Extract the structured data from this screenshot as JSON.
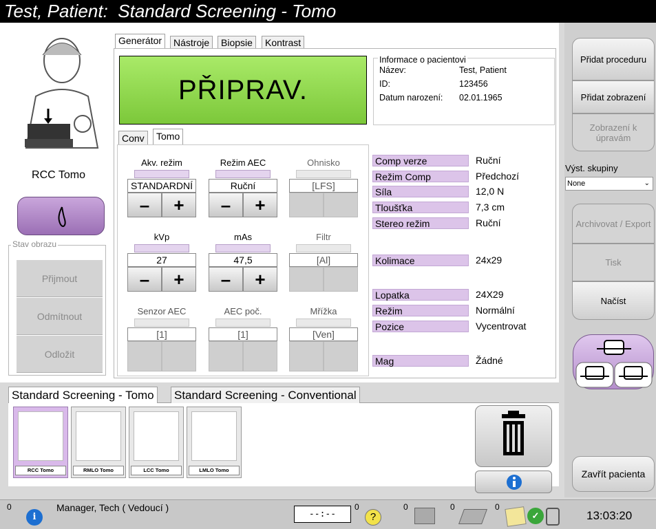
{
  "title": {
    "patient": "Test, Patient:",
    "procedure": "Standard Screening - Tomo"
  },
  "left": {
    "view_name": "RCC Tomo",
    "status_label": "Stav obrazu",
    "accept": "Přijmout",
    "reject": "Odmítnout",
    "pend": "Odložit"
  },
  "tabs": [
    "Generátor",
    "Nástroje",
    "Biopsie",
    "Kontrast"
  ],
  "status_message": "PŘIPRAV.",
  "patient_info": {
    "header": "Informace o pacientovi",
    "name_label": "Název:",
    "name": "Test, Patient",
    "id_label": "ID:",
    "id": "123456",
    "dob_label": "Datum narození:",
    "dob": "02.01.1965"
  },
  "subtabs": [
    "Conv",
    "Tomo"
  ],
  "controls": {
    "akv_label": "Akv. režim",
    "akv_value": "STANDARDNÍ",
    "aec_label": "Režim AEC",
    "aec_value": "Ruční",
    "ohnisko_label": "Ohnisko",
    "ohnisko_value": "[LFS]",
    "kvp_label": "kVp",
    "kvp_value": "27",
    "mas_label": "mAs",
    "mas_value": "47,5",
    "filtr_label": "Filtr",
    "filtr_value": "[Al]",
    "senzor_label": "Senzor AEC",
    "senzor_value": "[1]",
    "aecpoc_label": "AEC poč.",
    "aecpoc_value": "[1]",
    "mrizka_label": "Mřížka",
    "mrizka_value": "[Ven]",
    "minus": "–",
    "plus": "+"
  },
  "params": [
    {
      "label": "Comp verze",
      "value": "Ruční"
    },
    {
      "label": "Režim Comp",
      "value": "Předchozí"
    },
    {
      "label": "Síla",
      "value": "12,0 N"
    },
    {
      "label": "Tloušťka",
      "value": "7,3 cm"
    },
    {
      "label": "Stereo režim",
      "value": "Ruční"
    },
    {
      "label": "Kolimace",
      "value": "24x29"
    },
    {
      "label": "Lopatka",
      "value": "24X29"
    },
    {
      "label": "Režim",
      "value": "Normální"
    },
    {
      "label": "Pozice",
      "value": "Vycentrovat"
    },
    {
      "label": "Mag",
      "value": "Žádné"
    }
  ],
  "procedure_tabs": [
    "Standard Screening - Tomo",
    "Standard Screening - Conventional"
  ],
  "thumbnails": [
    "RCC Tomo",
    "RMLO Tomo",
    "LCC Tomo",
    "LMLO Tomo"
  ],
  "sidebar": {
    "add_procedure": "Přidat proceduru",
    "add_view": "Přidat zobrazení",
    "edit_view": "Zobrazení k úpravám",
    "output_groups_label": "Výst. skupiny",
    "output_groups_value": "None",
    "archive": "Archivovat / Export",
    "print": "Tisk",
    "retrieve": "Načíst",
    "close_patient": "Zavřít pacienta"
  },
  "statusbar": {
    "alarm_count": "0",
    "user": "Manager, Tech ( Vedoucí )",
    "timer": "--:--",
    "count1": "0",
    "count2": "0",
    "count3": "0",
    "count4": "0",
    "count5": "0",
    "time": "13:03:20"
  },
  "colors": {
    "ready_green": "#8fd84d",
    "accent_purple": "#b58fcc"
  }
}
